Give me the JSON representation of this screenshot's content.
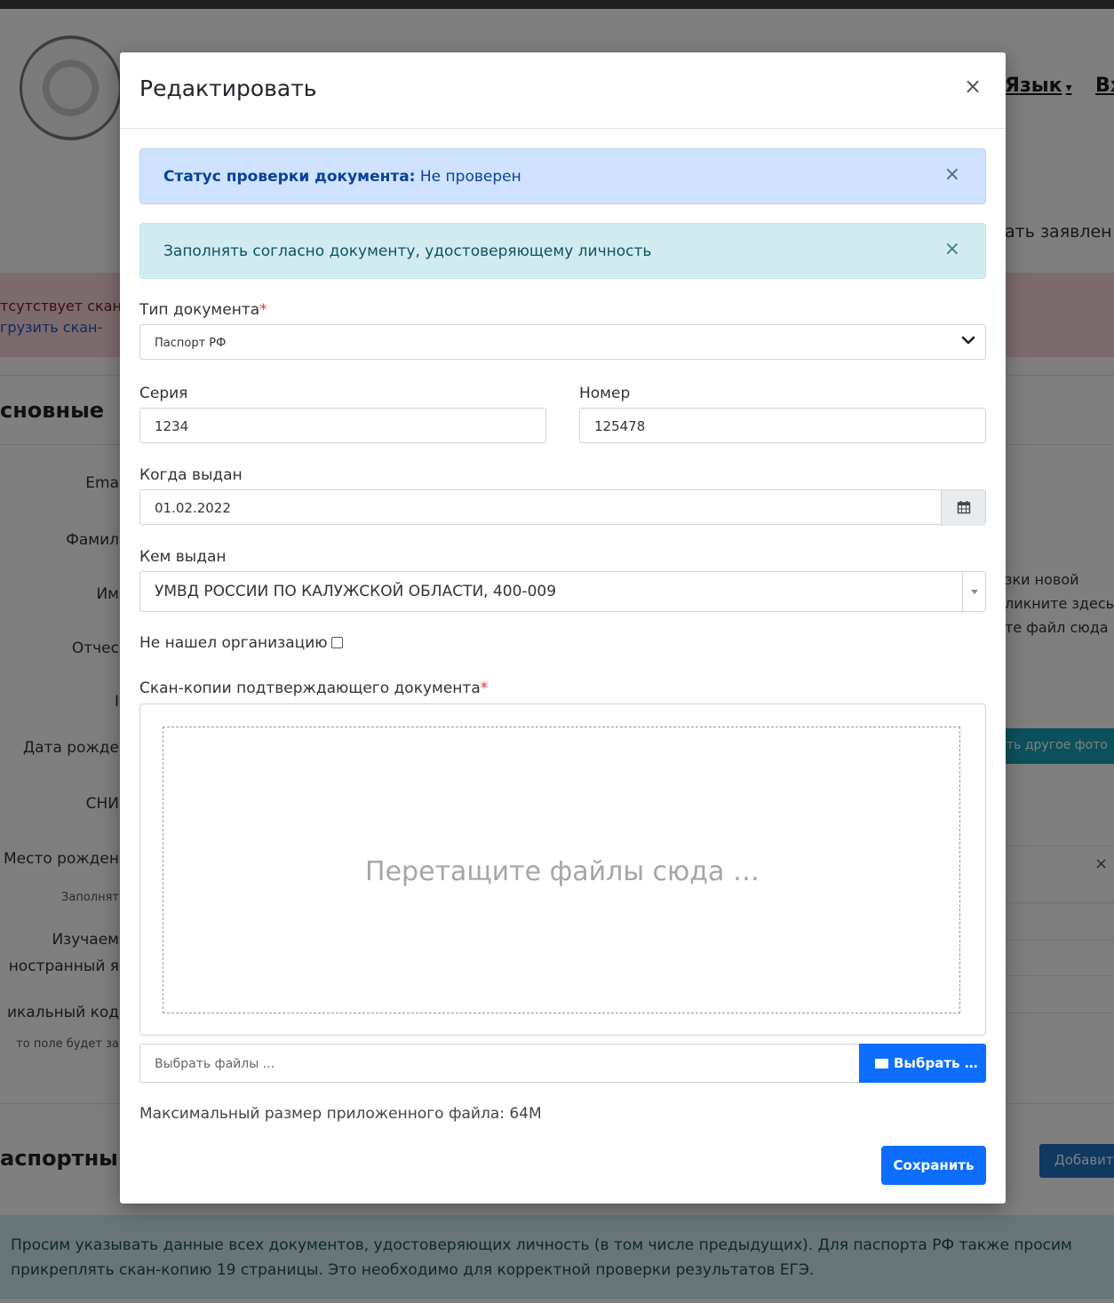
{
  "background": {
    "nav": {
      "lang": "Язык",
      "next": "Вх"
    },
    "right_text": "ать заявлен",
    "pink_alert": {
      "line1": "тсутствует скан",
      "line2": "грузить скан-"
    },
    "section_main": "сновные",
    "labels": [
      "Ema",
      "Фамил",
      "Им",
      "Отчес",
      "I",
      "Дата рожде",
      "СНИ",
      "Место рожден",
      "Заполнят",
      "Изучаем",
      "ностранный я",
      "икальный код",
      "то поле будет за"
    ],
    "right_hint": [
      "зки новой",
      "ликните здесь",
      "те файл сюда"
    ],
    "teal_button": "ть другое фото",
    "close_x": "×",
    "section_passport": "аспортны",
    "add_button": "Добавить",
    "bottom_alert": "Просим указывать данные всех документов, удостоверяющих личность (в том числе предыдущих). Для паспорта РФ также просим прикреплять скан-копию 19 страницы. Это необходимо для корректной проверки результатов ЕГЭ."
  },
  "modal": {
    "title": "Редактировать",
    "close": "×",
    "status_alert": {
      "label": "Статус проверки документа:",
      "value": " Не проверен",
      "close": "×"
    },
    "info_alert": {
      "text": "Заполнять согласно документу, удостоверяющему личность",
      "close": "×"
    },
    "doc_type": {
      "label": "Тип документа",
      "required": "*",
      "value": "Паспорт РФ"
    },
    "series": {
      "label": "Серия",
      "value": "1234"
    },
    "number": {
      "label": "Номер",
      "value": "125478"
    },
    "issued_date": {
      "label": "Когда выдан",
      "value": "01.02.2022"
    },
    "issued_by": {
      "label": "Кем выдан",
      "value": "УМВД РОССИИ ПО КАЛУЖСКОЙ ОБЛАСТИ, 400-009"
    },
    "not_found_org": {
      "label": "Не нашел организацию"
    },
    "scans": {
      "label": "Скан-копии подтверждающего документа",
      "required": "*",
      "dropzone_text": "Перетащите файлы сюда …"
    },
    "file_input": {
      "caption": "Выбрать файлы ...",
      "button": "Выбрать …"
    },
    "max_size": "Максимальный размер приложенного файла: 64M",
    "save_button": "Сохранить"
  },
  "colors": {
    "primary": "#0d6efd",
    "info_blue": "#cfe2ff",
    "info_teal": "#d1ecf1",
    "required": "#dc3545"
  }
}
